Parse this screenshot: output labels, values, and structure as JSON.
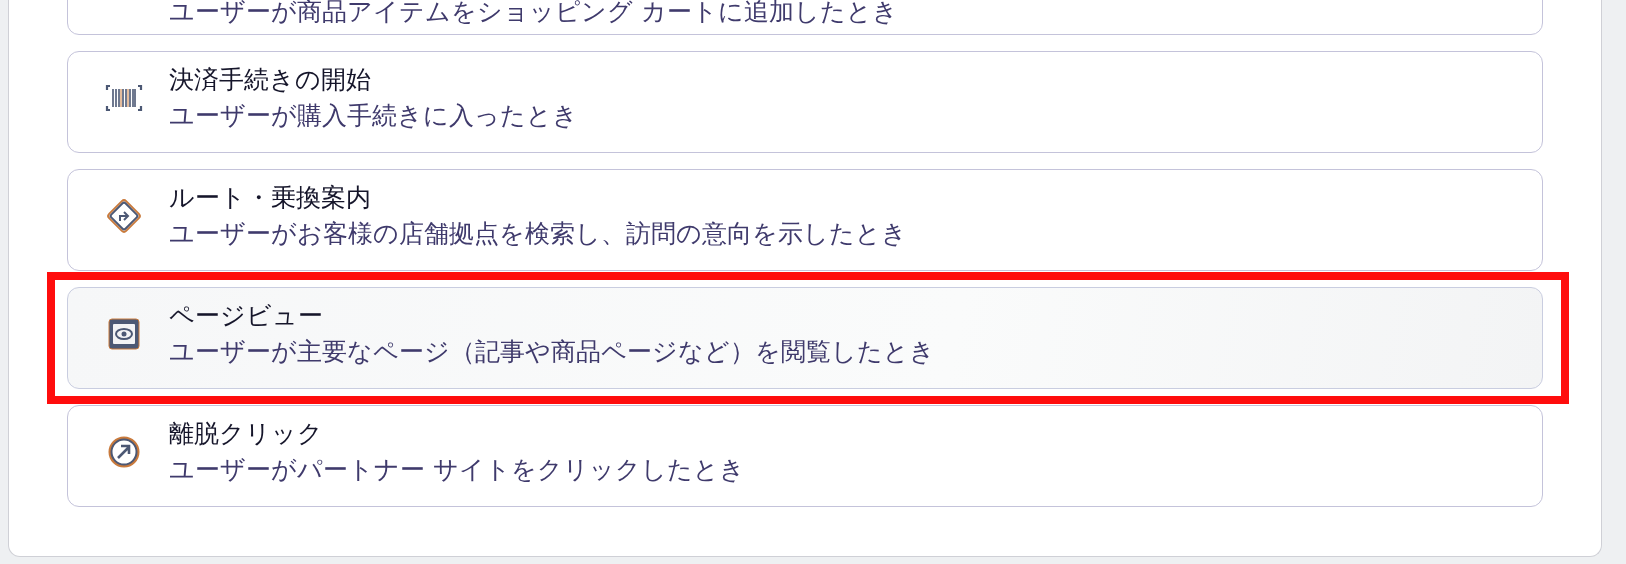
{
  "events": [
    {
      "description": "ユーザーが商品アイテムをショッピング カートに追加したとき",
      "selected": false,
      "highlighted": false
    },
    {
      "kind": "barcode",
      "title": "決済手続きの開始",
      "description": "ユーザーが購入手続きに入ったとき",
      "selected": false,
      "highlighted": false
    },
    {
      "kind": "route",
      "title": "ルート・乗換案内",
      "description": "ユーザーがお客様の店舗拠点を検索し、訪問の意向を示したとき",
      "selected": false,
      "highlighted": false
    },
    {
      "kind": "eye",
      "title": "ページビュー",
      "description": "ユーザーが主要なページ（記事や商品ページなど）を閲覧したとき",
      "selected": true,
      "highlighted": true
    },
    {
      "kind": "exit",
      "title": "離脱クリック",
      "description": "ユーザーがパートナー サイトをクリックしたとき",
      "selected": false,
      "highlighted": false
    }
  ]
}
